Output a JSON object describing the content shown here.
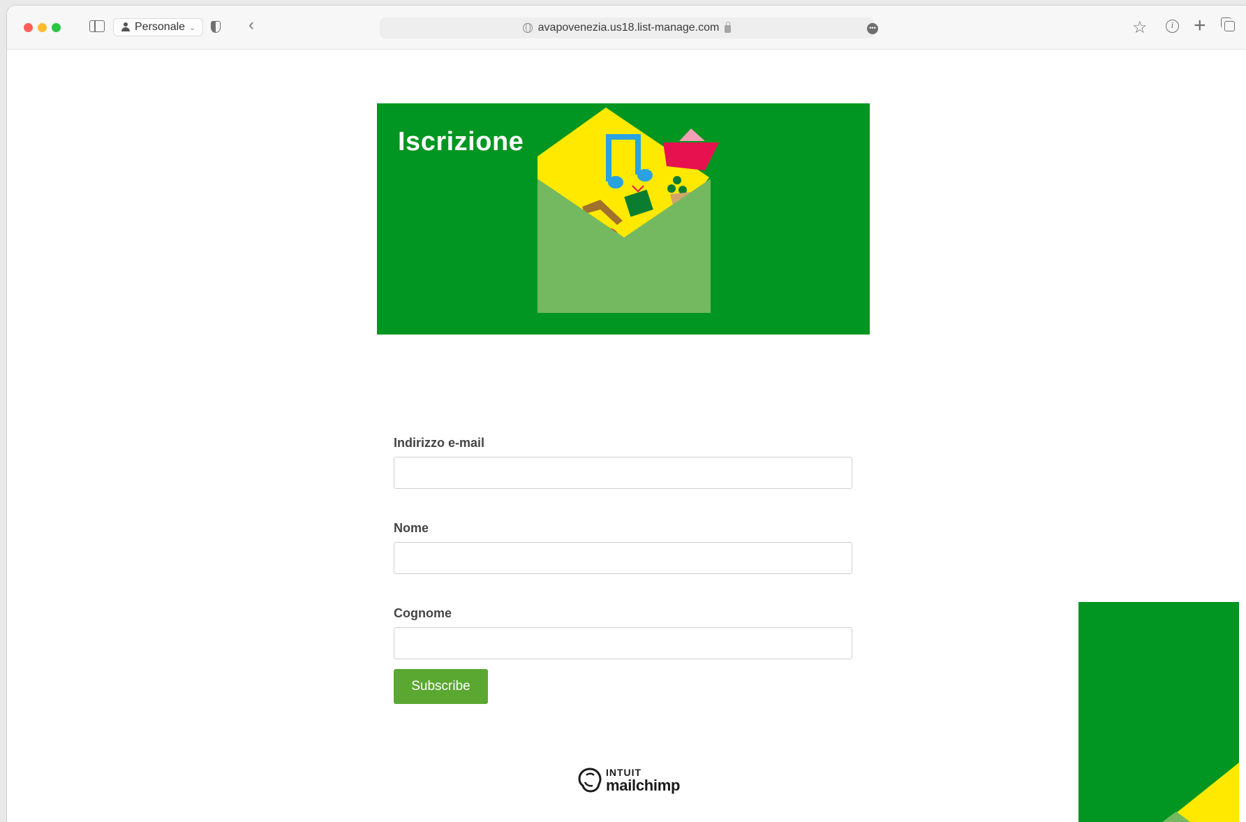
{
  "browser": {
    "profile_label": "Personale",
    "url": "avapovenezia.us18.list-manage.com"
  },
  "banner": {
    "title": "Iscrizione",
    "background_color": "#009621"
  },
  "form": {
    "email_label": "Indirizzo e-mail",
    "email_value": "",
    "first_name_label": "Nome",
    "first_name_value": "",
    "last_name_label": "Cognome",
    "last_name_value": "",
    "submit_label": "Subscribe",
    "submit_color": "#5aa732"
  },
  "footer": {
    "logo_brand_top": "INTUIT",
    "logo_brand_name": "mailchimp"
  }
}
